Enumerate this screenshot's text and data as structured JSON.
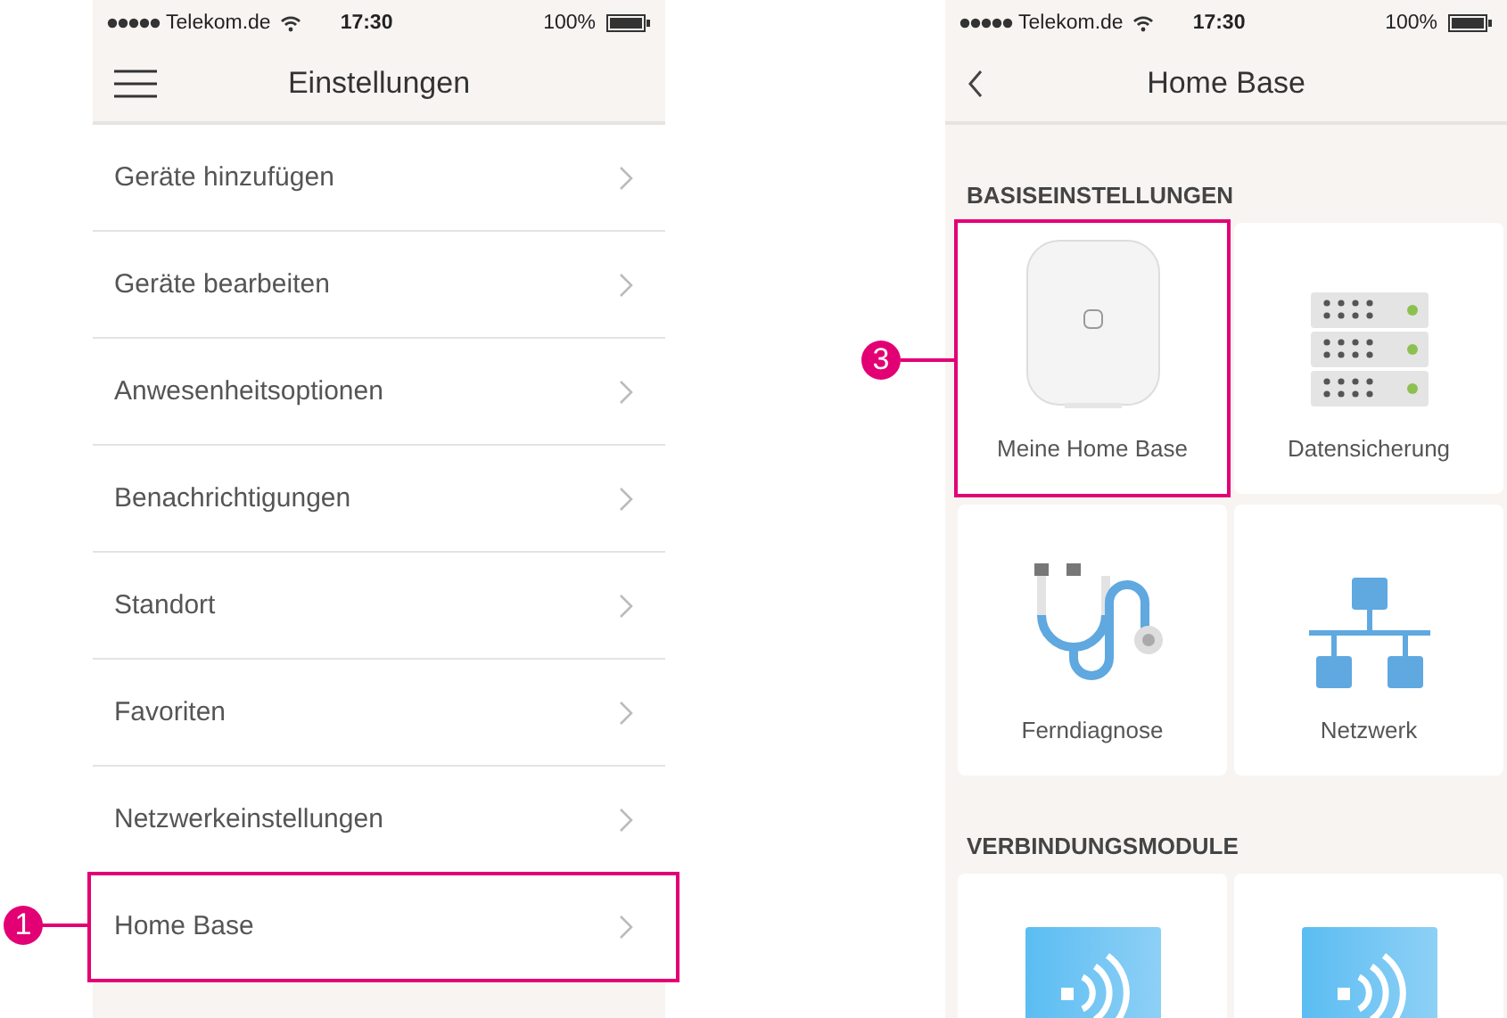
{
  "settings_screen": {
    "status_bar": {
      "carrier": "Telekom.de",
      "time": "17:30",
      "battery": "100%"
    },
    "header": {
      "kind": "menu",
      "title": "Einstellungen"
    },
    "items": [
      {
        "label": "Geräte hinzufügen"
      },
      {
        "label": "Geräte bearbeiten"
      },
      {
        "label": "Anwesenheitsoptionen"
      },
      {
        "label": "Benachrichtigungen"
      },
      {
        "label": "Standort"
      },
      {
        "label": "Favoriten"
      },
      {
        "label": "Netzwerkeinstellungen"
      },
      {
        "label": "Home Base",
        "callout": "1"
      }
    ]
  },
  "home_base_screen": {
    "status_bar": {
      "carrier": "Telekom.de",
      "time": "17:30",
      "battery": "100%"
    },
    "header": {
      "kind": "back",
      "title": "Home Base"
    },
    "sections": [
      {
        "title": "BASISEINSTELLUNGEN",
        "tiles": [
          {
            "kind": "device",
            "label": "Meine Home Base",
            "callout": "3"
          },
          {
            "kind": "backup",
            "label": "Datensicherung"
          },
          {
            "kind": "diagnosis",
            "label": "Ferndiagnose"
          },
          {
            "kind": "network",
            "label": "Netzwerk"
          }
        ]
      },
      {
        "title": "VERBINDUNGSMODULE",
        "tiles": [
          {
            "kind": "module"
          },
          {
            "kind": "module"
          }
        ]
      }
    ]
  }
}
